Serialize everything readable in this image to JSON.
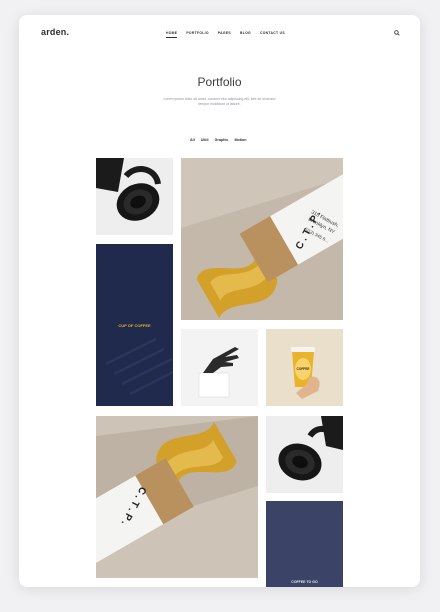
{
  "header": {
    "logo": "arden.",
    "nav": [
      "HOME",
      "PORTFOLIO",
      "PAGES",
      "BLOG",
      "CONTACT US"
    ],
    "active_nav": "HOME"
  },
  "page": {
    "title": "Portfolio",
    "subtitle": "Lorem ipsum dolor sit amet, consect etur adipiscing elit, sed do eiusmod tempor incididunt ut labore."
  },
  "filters": [
    "All",
    "Uiiiii",
    "Graphic",
    "Motion"
  ],
  "portfolio": {
    "poster_text": "CUP OF COFFEE",
    "poster_text_bottom": "COFFEE TO GO",
    "tube_letters": "C . T . P .",
    "tube_address_1": "315 Flatbush,",
    "tube_address_2": "Brooklyn, NY",
    "tube_phone": "(012) 345 6...",
    "cup_label": "COFFEE"
  },
  "colors": {
    "navy": "#1f2a4d",
    "navy_muted": "#3b4466",
    "gold": "#d9aa2b",
    "kraft": "#c7a47a",
    "accent_yellow": "#e9b32b",
    "text_dark": "#2d2f36"
  }
}
